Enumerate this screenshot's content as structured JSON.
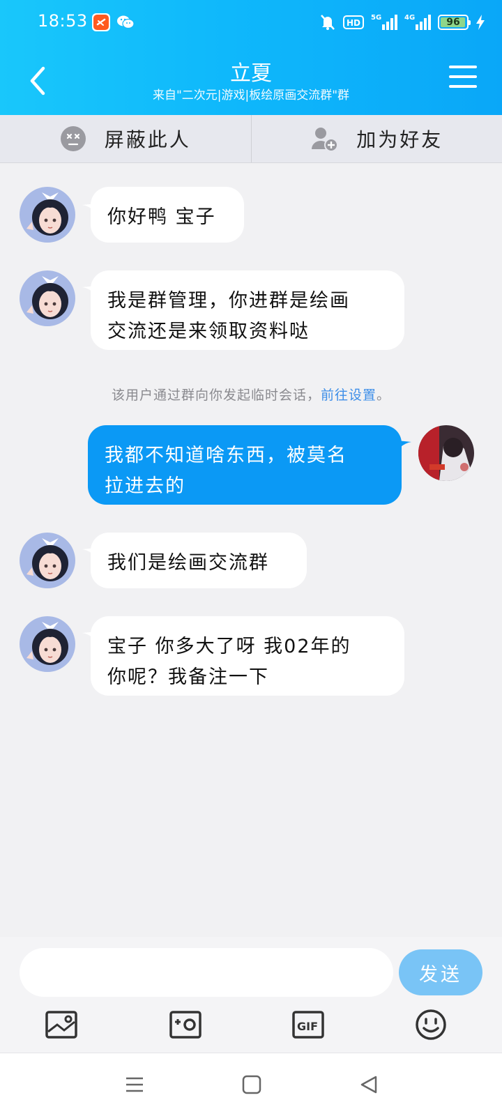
{
  "status_bar": {
    "time": "18:53",
    "battery": "96",
    "battery_level": 0.96,
    "network": "5G",
    "network2": "4G",
    "hd": "HD",
    "icons": [
      "taobao-app-icon",
      "wechat-icon",
      "mute-icon",
      "hd-icon",
      "signal-5g-icon",
      "signal-4g-icon",
      "battery-icon",
      "charging-icon"
    ]
  },
  "header": {
    "title": "立夏",
    "subtitle": "来自\"二次元|游戏|板绘原画交流群\"群",
    "back_icon": "chevron-left-icon",
    "menu_icon": "hamburger-menu-icon"
  },
  "actions": {
    "block": "屏蔽此人",
    "add_friend": "加为好友"
  },
  "messages": [
    {
      "from": "other",
      "text": "你好鸭 宝子"
    },
    {
      "from": "other",
      "text_line1": "我是群管理，你进群是绘画",
      "text_line2": "交流还是来领取资料哒"
    },
    {
      "from": "mine",
      "text_line1": "我都不知道啥东西，被莫名",
      "text_line2": "拉进去的"
    },
    {
      "from": "other",
      "text": "我们是绘画交流群"
    },
    {
      "from": "other",
      "text_line1": "宝子 你多大了呀 我02年的",
      "text_line2": "你呢？我备注一下"
    }
  ],
  "system_note": {
    "text": "该用户通过群向你发起临时会话，",
    "link": "前往设置",
    "end": "。"
  },
  "input": {
    "value": "",
    "send": "发送"
  },
  "colors": {
    "header_start": "#19c7fb",
    "header_end": "#0aa7f8",
    "my_bubble": "#0b99f5",
    "send_button": "#79c4f6",
    "link": "#3d8ee8"
  }
}
